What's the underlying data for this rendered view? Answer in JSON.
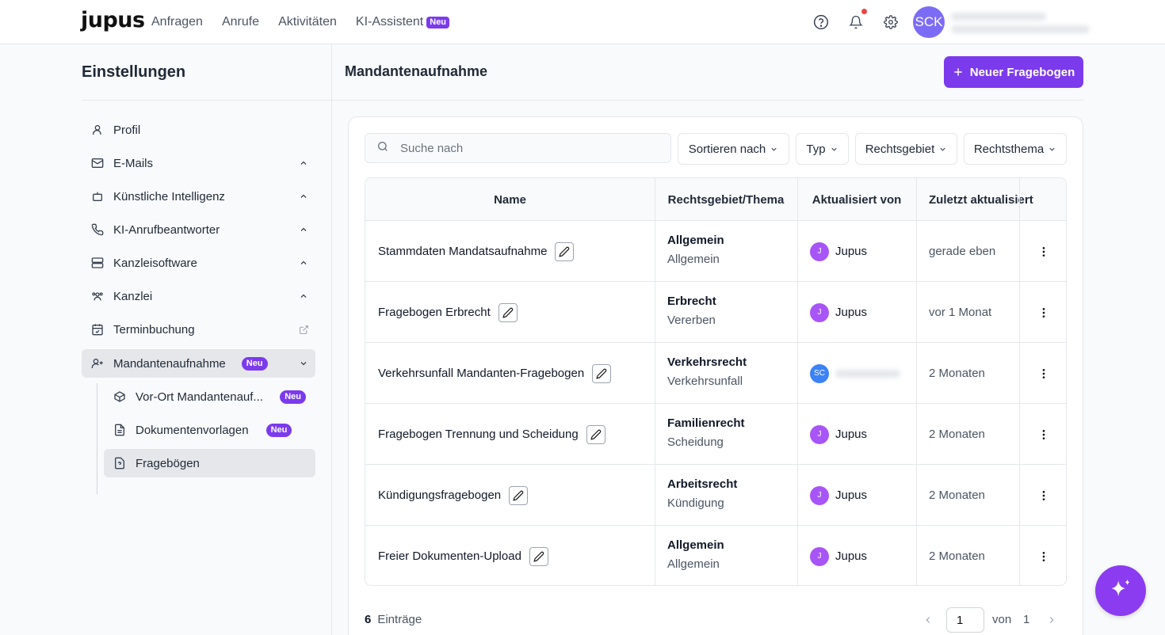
{
  "brand": {
    "logo": "jupus"
  },
  "nav": {
    "items": [
      {
        "label": "Anfragen"
      },
      {
        "label": "Anrufe"
      },
      {
        "label": "Aktivitäten"
      },
      {
        "label": "KI-Assistent",
        "badge": "Neu"
      }
    ]
  },
  "user": {
    "initials": "SCK"
  },
  "sidebar": {
    "title": "Einstellungen",
    "items": [
      {
        "label": "Profil",
        "icon": "user-icon"
      },
      {
        "label": "E-Mails",
        "icon": "mail-icon",
        "chevron": "up"
      },
      {
        "label": "Künstliche Intelligenz",
        "icon": "bot-icon",
        "chevron": "up"
      },
      {
        "label": "KI-Anrufbeantworter",
        "icon": "phone-icon",
        "chevron": "up"
      },
      {
        "label": "Kanzleisoftware",
        "icon": "server-icon",
        "chevron": "up"
      },
      {
        "label": "Kanzlei",
        "icon": "users-icon",
        "chevron": "up"
      },
      {
        "label": "Terminbuchung",
        "icon": "calendar-icon",
        "trailing": "external-link-icon"
      },
      {
        "label": "Mandantenaufnahme",
        "icon": "user-plus-icon",
        "badge": "Neu",
        "chevron": "down",
        "active": true
      }
    ],
    "subitems": [
      {
        "label": "Vor-Ort Mandantenauf...",
        "icon": "box-icon",
        "badge": "Neu"
      },
      {
        "label": "Dokumentenvorlagen",
        "icon": "document-icon",
        "badge": "Neu"
      },
      {
        "label": "Fragebögen",
        "icon": "question-file-icon",
        "active": true
      }
    ]
  },
  "main": {
    "title": "Mandantenaufnahme",
    "new_button": "Neuer Fragebogen",
    "search_placeholder": "Suche nach",
    "filters": [
      "Sortieren nach",
      "Typ",
      "Rechtsgebiet",
      "Rechtsthema"
    ],
    "columns": [
      "Name",
      "Rechtsgebiet/Thema",
      "Aktualisiert von",
      "Zuletzt aktualisiert"
    ],
    "rows": [
      {
        "name": "Stammdaten Mandatsaufnahme",
        "area": "Allgemein",
        "topic": "Allgemein",
        "user_initial": "J",
        "user": "Jupus",
        "updated": "gerade eben"
      },
      {
        "name": "Fragebogen Erbrecht",
        "area": "Erbrecht",
        "topic": "Vererben",
        "user_initial": "J",
        "user": "Jupus",
        "updated": "vor 1 Monat"
      },
      {
        "name": "Verkehrsunfall Mandanten-Fragebogen",
        "area": "Verkehrsrecht",
        "topic": "Verkehrsunfall",
        "user_initial": "SC",
        "user": "",
        "updated": "2 Monaten"
      },
      {
        "name": "Fragebogen Trennung und Scheidung",
        "area": "Familienrecht",
        "topic": "Scheidung",
        "user_initial": "J",
        "user": "Jupus",
        "updated": "2 Monaten"
      },
      {
        "name": "Kündigungsfragebogen",
        "area": "Arbeitsrecht",
        "topic": "Kündigung",
        "user_initial": "J",
        "user": "Jupus",
        "updated": "2 Monaten"
      },
      {
        "name": "Freier Dokumenten-Upload",
        "area": "Allgemein",
        "topic": "Allgemein",
        "user_initial": "J",
        "user": "Jupus",
        "updated": "2 Monaten"
      }
    ],
    "footer": {
      "count": "6",
      "count_label": "Einträge",
      "page": "1",
      "of_label": "von",
      "total_pages": "1"
    }
  },
  "colors": {
    "accent": "#7c3aed",
    "fab": "#8b3cf0"
  }
}
